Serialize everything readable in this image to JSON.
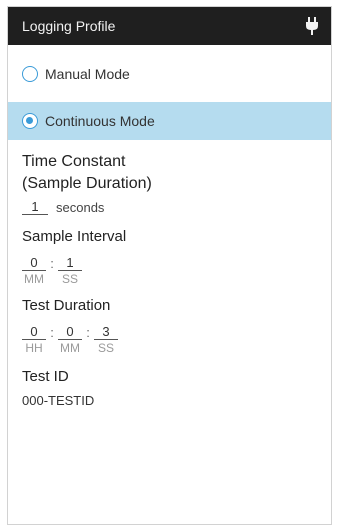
{
  "header": {
    "title": "Logging Profile",
    "icon": "plug-icon"
  },
  "modes": {
    "manual_label": "Manual Mode",
    "continuous_label": "Continuous Mode",
    "selected": "continuous"
  },
  "time_constant": {
    "title_line1": "Time Constant",
    "title_line2": "(Sample Duration)",
    "value": "1",
    "unit": "seconds"
  },
  "sample_interval": {
    "title": "Sample Interval",
    "minutes": "0",
    "seconds": "1",
    "minutes_label": "MM",
    "seconds_label": "SS",
    "separator": ":"
  },
  "test_duration": {
    "title": "Test Duration",
    "hours": "0",
    "minutes": "0",
    "seconds": "3",
    "hours_label": "HH",
    "minutes_label": "MM",
    "seconds_label": "SS",
    "separator": ":"
  },
  "test_id": {
    "title": "Test ID",
    "value": "000-TESTID"
  },
  "colors": {
    "header_bg": "#1f1f1f",
    "selected_bg": "#b5dcef",
    "radio_accent": "#3a9bd8"
  }
}
